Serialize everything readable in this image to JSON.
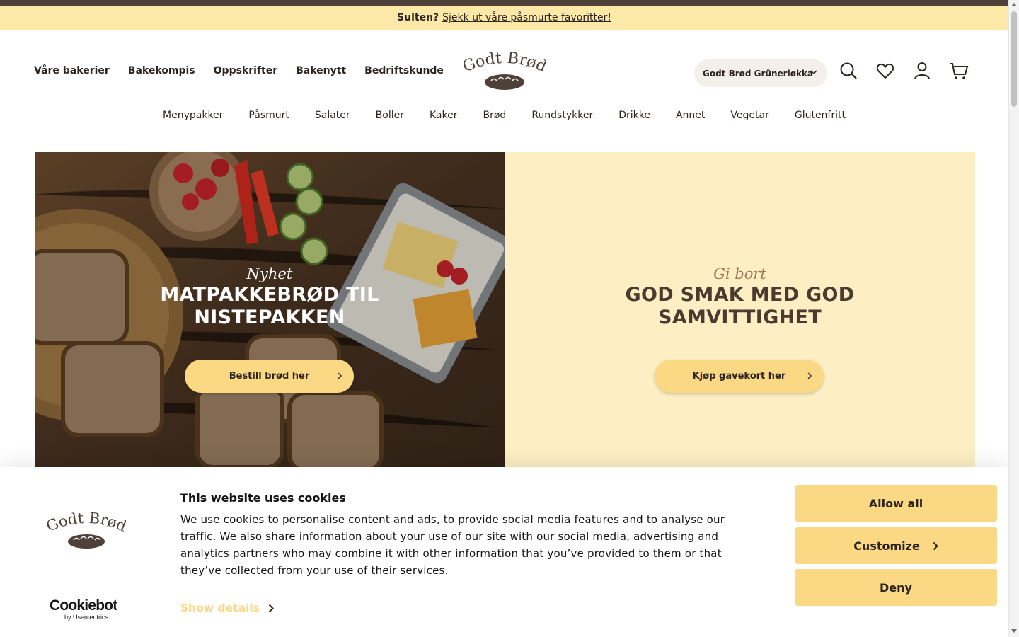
{
  "announcement": {
    "lead": "Sulten?",
    "link": "Sjekk ut våre påsmurte favoritter!"
  },
  "main_nav": [
    "Våre bakerier",
    "Bakekompis",
    "Oppskrifter",
    "Bakenytt",
    "Bedriftskunde"
  ],
  "brand": {
    "logo_text": "Godt Brød"
  },
  "store_select": {
    "value": "Godt Brød Grünerløkka"
  },
  "header_icons": [
    "search-icon",
    "heart-icon",
    "user-icon",
    "cart-icon"
  ],
  "category_nav": [
    "Menypakker",
    "Påsmurt",
    "Salater",
    "Boller",
    "Kaker",
    "Brød",
    "Rundstykker",
    "Drikke",
    "Annet",
    "Vegetar",
    "Glutenfritt"
  ],
  "hero": {
    "left": {
      "kicker": "Nyhet",
      "title_line1": "MATPAKKEBRØD TIL",
      "title_line2": "NISTEPAKKEN",
      "cta": "Bestill brød her"
    },
    "right": {
      "kicker": "Gi bort",
      "title_line1": "GOD SMAK MED GOD",
      "title_line2": "SAMVITTIGHET",
      "cta": "Kjøp gavekort her"
    }
  },
  "cookie_banner": {
    "title": "This website uses cookies",
    "body": "We use cookies to personalise content and ads, to provide social media features and to analyse our traffic. We also share information about your use of our site with our social media, advertising and analytics partners who may combine it with other information that you’ve provided to them or that they’ve collected from your use of their services.",
    "show_details": "Show details",
    "allow_all": "Allow all",
    "customize": "Customize",
    "deny": "Deny",
    "provider": "Cookiebot",
    "provider_sub": "by Usercentrics"
  },
  "colors": {
    "accent": "#fbd884",
    "announcement_bg": "#fce9a8",
    "hero_right_bg": "#fdefc3",
    "text": "#2d2420",
    "brand_brown": "#4f4038"
  }
}
